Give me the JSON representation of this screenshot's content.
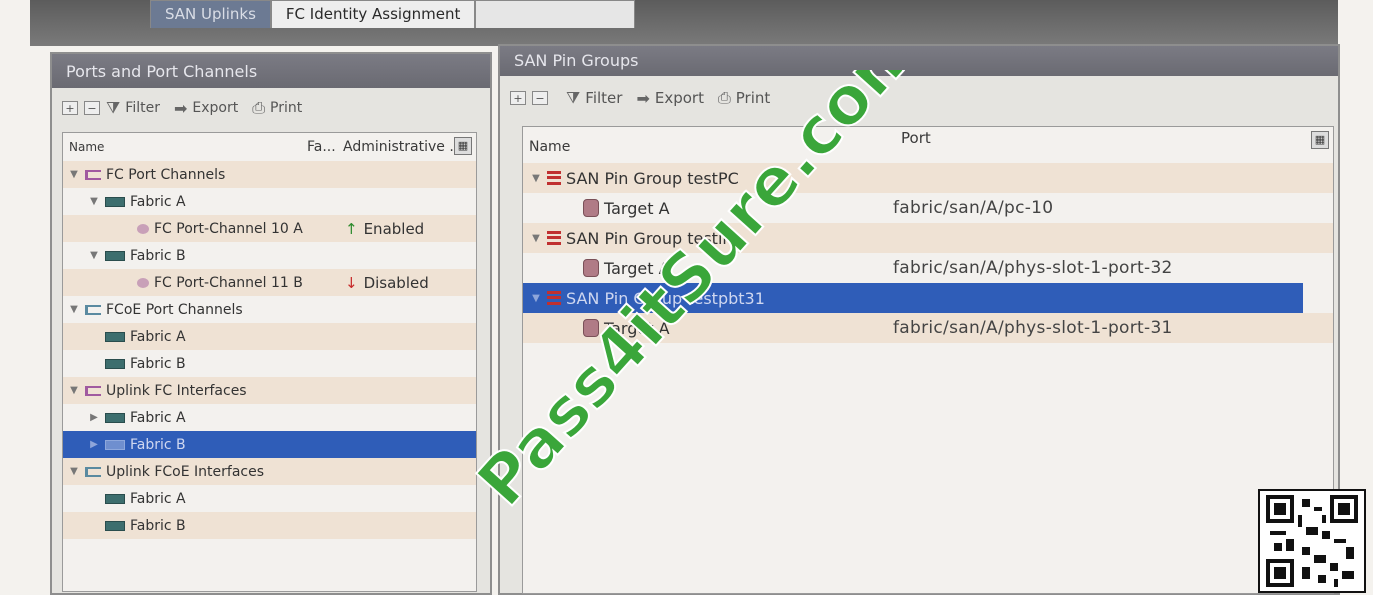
{
  "tabs": [
    {
      "label": "SAN Uplinks"
    },
    {
      "label": "FC Identity Assignment"
    }
  ],
  "left_panel": {
    "title": "Ports and Port Channels",
    "toolbar": {
      "filter": "Filter",
      "export": "Export",
      "print": "Print"
    },
    "columns": [
      "Name",
      "Fa...",
      "Administrative ..."
    ],
    "rows": [
      {
        "label": "FC Port Channels",
        "state": ""
      },
      {
        "label": "Fabric A",
        "state": ""
      },
      {
        "label": "FC Port-Channel 10 A",
        "state": "Enabled"
      },
      {
        "label": "Fabric B",
        "state": ""
      },
      {
        "label": "FC Port-Channel 11 B",
        "state": "Disabled"
      },
      {
        "label": "FCoE Port Channels",
        "state": ""
      },
      {
        "label": "Fabric A",
        "state": ""
      },
      {
        "label": "Fabric B",
        "state": ""
      },
      {
        "label": "Uplink FC Interfaces",
        "state": ""
      },
      {
        "label": "Fabric A",
        "state": ""
      },
      {
        "label": "Fabric B",
        "state": ""
      },
      {
        "label": "Uplink FCoE Interfaces",
        "state": ""
      },
      {
        "label": "Fabric A",
        "state": ""
      },
      {
        "label": "Fabric B",
        "state": ""
      }
    ]
  },
  "right_panel": {
    "title": "SAN Pin Groups",
    "toolbar": {
      "filter": "Filter",
      "export": "Export",
      "print": "Print"
    },
    "columns": [
      "Name",
      "Port"
    ],
    "rows": [
      {
        "label": "SAN Pin Group testPC",
        "port": ""
      },
      {
        "label": "Target A",
        "port": "fabric/san/A/pc-10"
      },
      {
        "label": "SAN Pin Group testint",
        "port": ""
      },
      {
        "label": "Target A",
        "port": "fabric/san/A/phys-slot-1-port-32"
      },
      {
        "label": "SAN Pin Group testpbt31",
        "port": ""
      },
      {
        "label": "Target A",
        "port": "fabric/san/A/phys-slot-1-port-31"
      }
    ]
  },
  "watermark": {
    "text": "Pass4itSure.com",
    "color": "#3aa63a"
  },
  "colors": {
    "selection": "#2f5db8",
    "enabled": "#2e8b2e",
    "disabled": "#c62a2a"
  }
}
